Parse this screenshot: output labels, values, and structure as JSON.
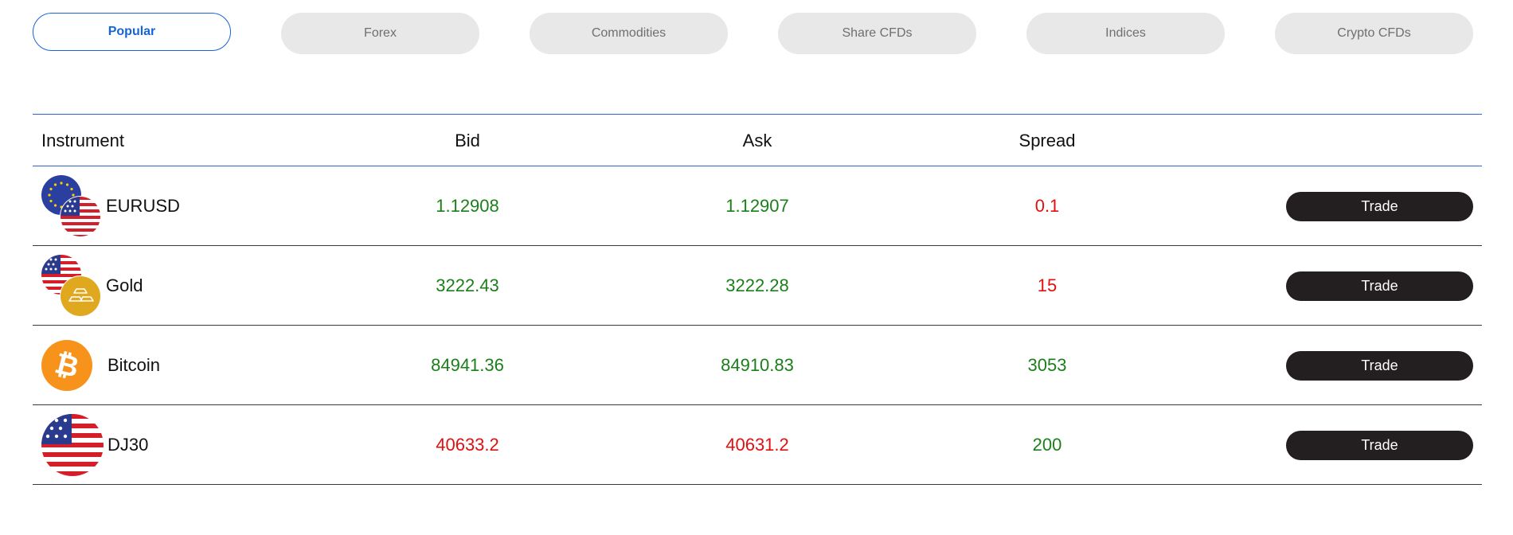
{
  "tabs": [
    {
      "label": "Popular",
      "active": true
    },
    {
      "label": "Forex",
      "active": false
    },
    {
      "label": "Commodities",
      "active": false
    },
    {
      "label": "Share CFDs",
      "active": false
    },
    {
      "label": "Indices",
      "active": false
    },
    {
      "label": "Crypto CFDs",
      "active": false
    }
  ],
  "table": {
    "headers": {
      "instrument": "Instrument",
      "bid": "Bid",
      "ask": "Ask",
      "spread": "Spread"
    },
    "rows": [
      {
        "instrument": "EURUSD",
        "bid": "1.12908",
        "ask": "1.12907",
        "spread": "0.1",
        "trade_label": "Trade",
        "icon": "eu-us-flags-icon",
        "bid_color": "green",
        "ask_color": "green",
        "spread_color": "red"
      },
      {
        "instrument": "Gold",
        "bid": "3222.43",
        "ask": "3222.28",
        "spread": "15",
        "trade_label": "Trade",
        "icon": "us-flag-gold-icon",
        "bid_color": "green",
        "ask_color": "green",
        "spread_color": "red"
      },
      {
        "instrument": "Bitcoin",
        "bid": "84941.36",
        "ask": "84910.83",
        "spread": "3053",
        "trade_label": "Trade",
        "icon": "bitcoin-icon",
        "bid_color": "green",
        "ask_color": "green",
        "spread_color": "green"
      },
      {
        "instrument": "DJ30",
        "bid": "40633.2",
        "ask": "40631.2",
        "spread": "200",
        "trade_label": "Trade",
        "icon": "us-flag-icon",
        "bid_color": "red",
        "ask_color": "red",
        "spread_color": "green"
      }
    ]
  },
  "colors": {
    "accent": "#1565d8",
    "positive": "#1a7f1a",
    "negative": "#e01010",
    "button": "#231f20",
    "tab_bg": "#e8e8e8"
  }
}
